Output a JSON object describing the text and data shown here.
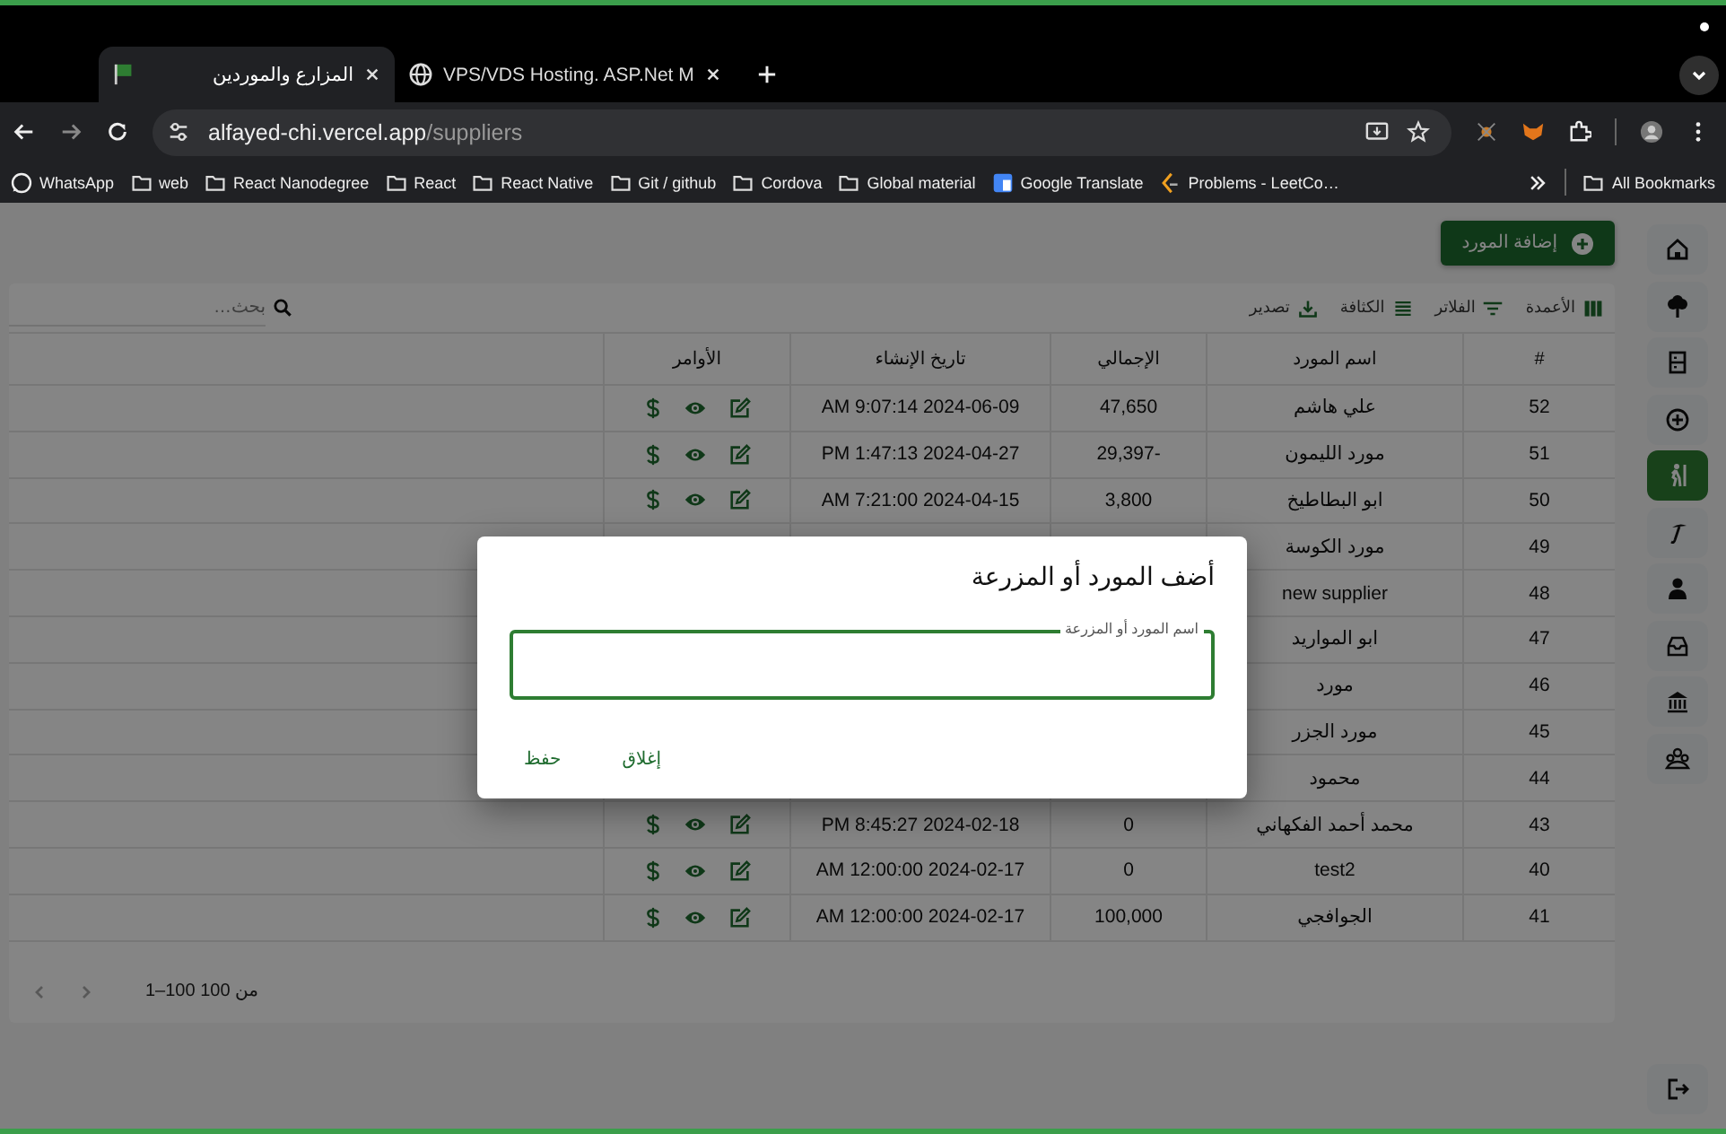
{
  "browser": {
    "tabs": [
      {
        "title": "VPS/VDS Hosting. ASP.Net M",
        "selected": false
      },
      {
        "title": "المزارع والموردين",
        "selected": true
      }
    ],
    "address": {
      "host": "alfayed-chi.vercel.app",
      "path": "/suppliers"
    },
    "bookmarks": [
      {
        "label": "Problems - LeetCo…",
        "kind": "site"
      },
      {
        "label": "Google Translate",
        "kind": "site"
      },
      {
        "label": "Global material",
        "kind": "folder"
      },
      {
        "label": "Cordova",
        "kind": "folder"
      },
      {
        "label": "Git / github",
        "kind": "folder"
      },
      {
        "label": "React Native",
        "kind": "folder"
      },
      {
        "label": "React",
        "kind": "folder"
      },
      {
        "label": "React Nanodegree",
        "kind": "folder"
      },
      {
        "label": "web",
        "kind": "folder"
      },
      {
        "label": "WhatsApp",
        "kind": "site"
      }
    ],
    "all_bookmarks": "All Bookmarks"
  },
  "add_button": "إضافة المورد",
  "toolbar": [
    "الأعمدة",
    "الفلاتر",
    "الكثافة",
    "تصدير"
  ],
  "search": {
    "placeholder": "بحث…"
  },
  "table": {
    "columns": [
      "#",
      "اسم المورد",
      "الإجمالي",
      "تاريخ الإنشاء",
      "الأوامر"
    ],
    "rows": [
      {
        "id": "52",
        "name": "علي هاشم",
        "total": "47,650",
        "created": "AM 9:07:14 2024-06-09"
      },
      {
        "id": "51",
        "name": "مورد الليمون",
        "total": "-29,397",
        "created": "PM 1:47:13 2024-04-27"
      },
      {
        "id": "50",
        "name": "ابو البطاطيخ",
        "total": "3,800",
        "created": "AM 7:21:00 2024-04-15"
      },
      {
        "id": "49",
        "name": "مورد الكوسة"
      },
      {
        "id": "48",
        "name": "new supplier"
      },
      {
        "id": "47",
        "name": "ابو المواريد"
      },
      {
        "id": "46",
        "name": "مورد"
      },
      {
        "id": "45",
        "name": "مورد الجزر"
      },
      {
        "id": "44",
        "name": "محمود"
      },
      {
        "id": "43",
        "name": "محمد أحمد الفكهاني",
        "total": "0",
        "created": "PM 8:45:27 2024-02-18"
      },
      {
        "id": "40",
        "name": "test2",
        "total": "0",
        "created": "AM 12:00:00 2024-02-17"
      },
      {
        "id": "41",
        "name": "الجوافجي",
        "total": "100,000",
        "created": "AM 12:00:00 2024-02-17"
      }
    ]
  },
  "pagination": "1–100 من 100",
  "sidebar": [
    {
      "selected": false
    },
    {
      "selected": false
    },
    {
      "selected": false
    },
    {
      "selected": false
    },
    {
      "selected": true
    },
    {
      "selected": false
    },
    {
      "selected": false
    },
    {
      "selected": false
    },
    {
      "selected": false
    },
    {
      "selected": false
    }
  ],
  "dialog": {
    "title": "أضف المورد أو المزرعة",
    "field_label": "اسم المورد أو المزرعة",
    "buttons": [
      "إغلاق",
      "حفظ"
    ]
  }
}
